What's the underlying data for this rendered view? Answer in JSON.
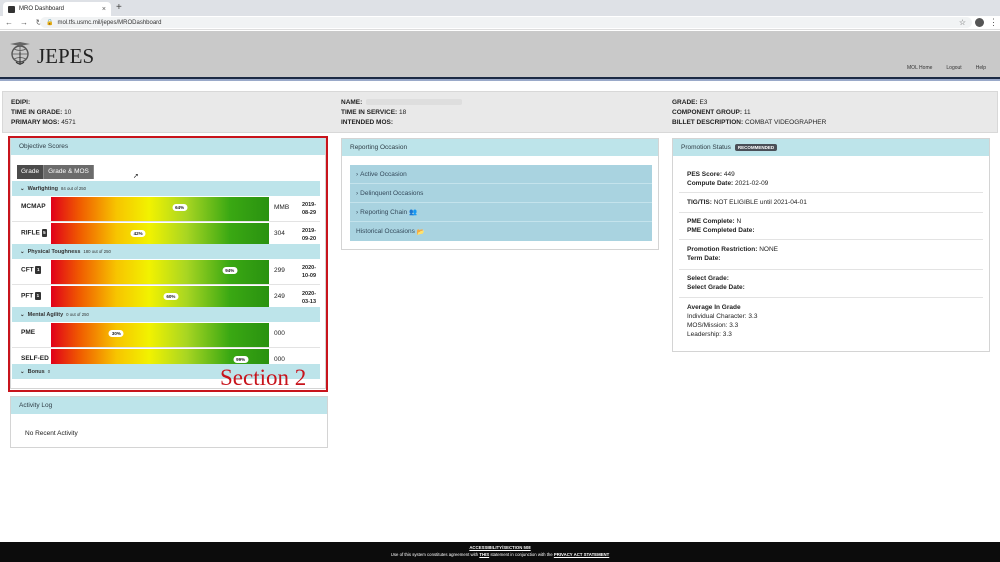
{
  "browser": {
    "tab_title": "MRO Dashboard",
    "url": "mol.tfs.usmc.mil/jepes/MRODashboard"
  },
  "header": {
    "brand": "JEPES",
    "links": [
      "MOL Home",
      "Logout",
      "Help"
    ]
  },
  "member": {
    "edipi_label": "EDIPI:",
    "tig_label": "TIME IN GRADE:",
    "tig_value": "10",
    "pmos_label": "PRIMARY MOS:",
    "pmos_value": "4571",
    "name_label": "NAME:",
    "tis_label": "TIME IN SERVICE:",
    "tis_value": "18",
    "imos_label": "INTENDED MOS:",
    "grade_label": "GRADE:",
    "grade_value": "E3",
    "comp_label": "COMPONENT GROUP:",
    "comp_value": "11",
    "billet_label": "BILLET DESCRIPTION:",
    "billet_value": "COMBAT VIDEOGRAPHER"
  },
  "objective": {
    "title": "Objective Scores",
    "tabs": [
      "Grade",
      "Grade & MOS"
    ],
    "sections": [
      {
        "name": "Warfighting",
        "score": "84 out of 250"
      },
      {
        "name": "Physical Toughness",
        "score": "180 out of 250"
      },
      {
        "name": "Mental Agility",
        "score": "0 out of 250"
      },
      {
        "name": "Bonus",
        "score": "0"
      }
    ],
    "rows": [
      {
        "label": "MCMAP",
        "badge": "",
        "pct": "64%",
        "pct_value": 0.59,
        "value": "MMB",
        "date": "2019-08-29"
      },
      {
        "label": "RIFLE",
        "badge": "5",
        "pct": "42%",
        "pct_value": 0.4,
        "value": "304",
        "date": "2019-09-20"
      },
      {
        "label": "CFT",
        "badge": "1",
        "pct": "94%",
        "pct_value": 0.82,
        "value": "299",
        "date": "2020-10-09"
      },
      {
        "label": "PFT",
        "badge": "1",
        "pct": "60%",
        "pct_value": 0.55,
        "value": "249",
        "date": "2020-03-13"
      },
      {
        "label": "PME",
        "badge": "",
        "pct": "30%",
        "pct_value": 0.3,
        "value": "000",
        "date": ""
      },
      {
        "label": "SELF-ED",
        "badge": "",
        "pct": "99%",
        "pct_value": 0.87,
        "value": "000",
        "date": ""
      }
    ],
    "annotation": "Section 2"
  },
  "activity": {
    "title": "Activity Log",
    "empty": "No Recent Activity"
  },
  "reporting": {
    "title": "Reporting Occasion",
    "items": [
      "Active Occasion",
      "Delinquent Occasions",
      "Reporting Chain",
      "Historical Occasions"
    ]
  },
  "promotion": {
    "title": "Promotion Status",
    "badge": "RECOMMENDED",
    "pes_label": "PES Score:",
    "pes_value": "449",
    "compute_label": "Compute Date:",
    "compute_value": "2021-02-09",
    "tig_label": "TIG/TIS:",
    "tig_value": "NOT ELIGIBLE until 2021-04-01",
    "pme_label": "PME Complete:",
    "pme_value": "N",
    "pmed_label": "PME Completed Date:",
    "restr_label": "Promotion Restriction:",
    "restr_value": "NONE",
    "term_label": "Term Date:",
    "sel_label": "Select Grade:",
    "seld_label": "Select Grade Date:",
    "avg_label": "Average In Grade",
    "avg_items": [
      "Individual Character: 3.3",
      "MOS/Mission: 3.3",
      "Leadership: 3.3"
    ]
  },
  "footer": {
    "line1": "ACCESSIBILITY/SECTION 508",
    "line2_a": "Use of this system constitutes agreement with ",
    "line2_this": "THIS",
    "line2_b": " statement in conjunction with the ",
    "line2_privacy": "PRIVACY ACT STATEMENT"
  }
}
